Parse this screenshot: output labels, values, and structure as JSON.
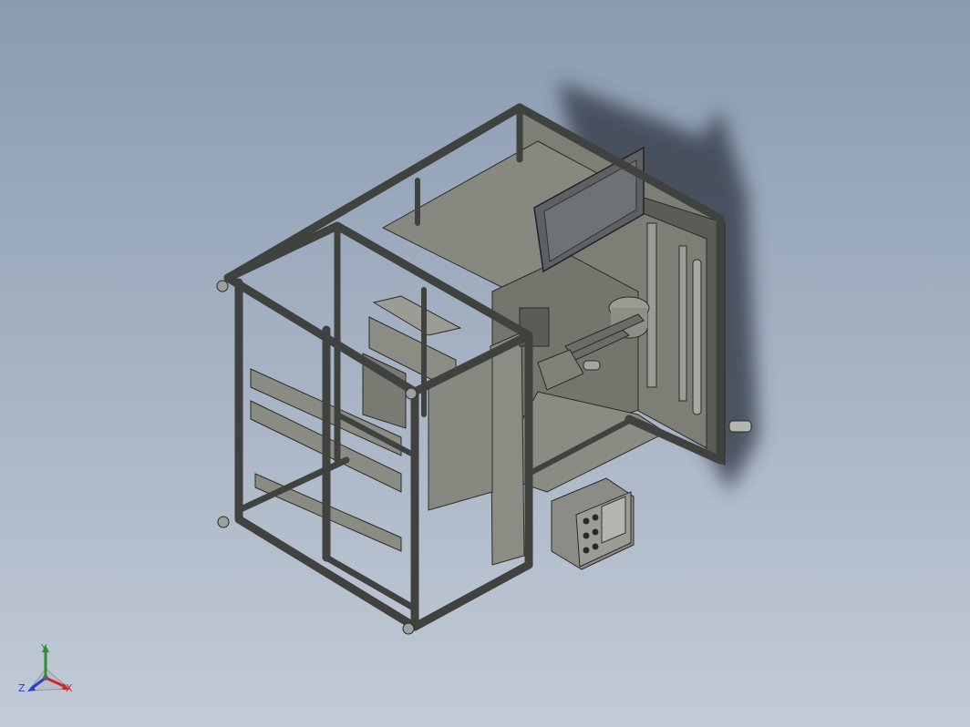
{
  "viewport": {
    "background_top": "#8a9bb0",
    "background_bottom": "#c2cbd6"
  },
  "model": {
    "frame_color": "#4a4d4a",
    "panel_color": "#85877e",
    "panel_dark": "#5e6058",
    "shadow_color": "#3a4250",
    "screen_color": "#6e7277",
    "foot_color": "#9aa09c"
  },
  "control_box": {
    "buttons": 6
  },
  "triad": {
    "y_label": "Y",
    "x_label": "X",
    "z_label": "Z",
    "x_color": "#cc2a2a",
    "y_color": "#2f8f2f",
    "z_color": "#2a3fd0"
  }
}
